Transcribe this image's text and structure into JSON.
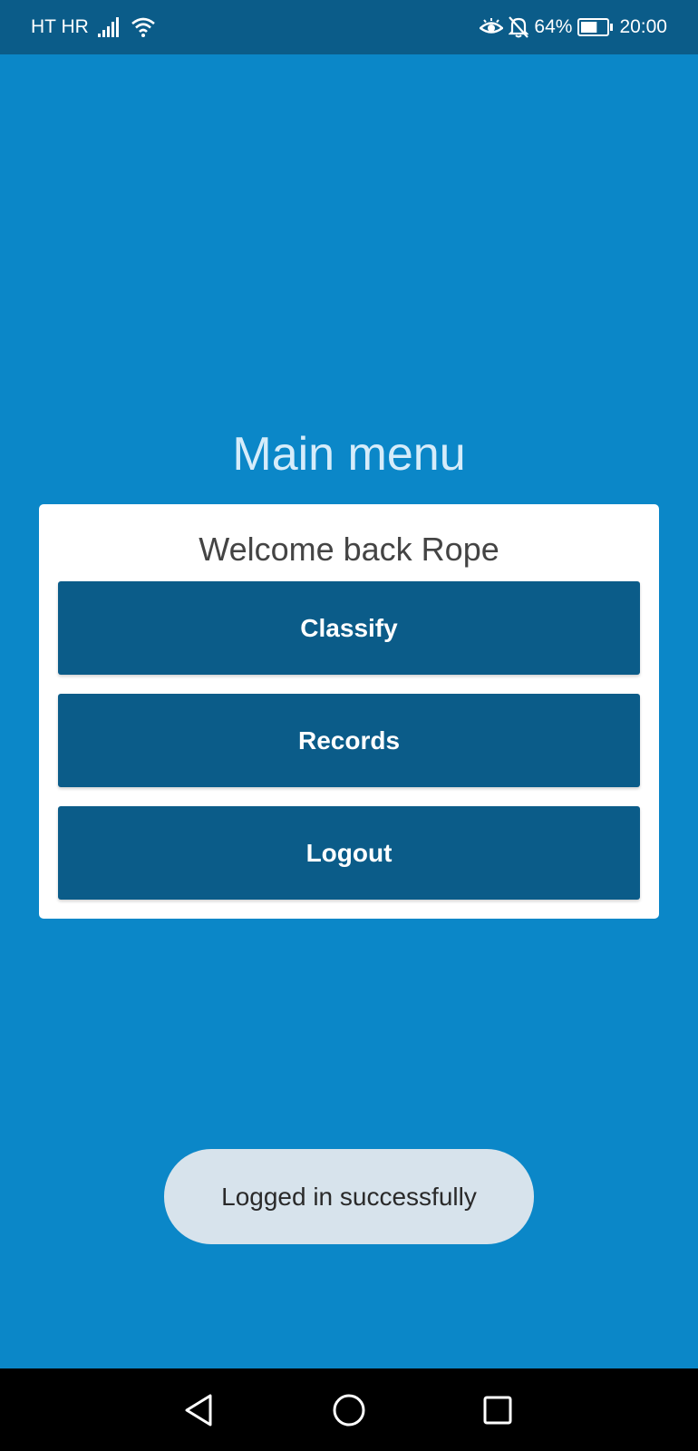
{
  "status_bar": {
    "carrier": "HT HR",
    "battery_percent": "64%",
    "battery_level": 0.64,
    "time": "20:00",
    "icons": [
      "signal-icon",
      "wifi-icon",
      "eye-icon",
      "bell-off-icon",
      "battery-icon"
    ]
  },
  "page": {
    "title": "Main menu"
  },
  "card": {
    "welcome": "Welcome back Rope",
    "buttons": {
      "classify": "Classify",
      "records": "Records",
      "logout": "Logout"
    }
  },
  "toast": {
    "message": "Logged in successfully"
  },
  "nav_bar": {
    "icons": [
      "back-icon",
      "home-icon",
      "recents-icon"
    ]
  },
  "colors": {
    "background": "#0b87c8",
    "status_bar": "#0b5c89",
    "button": "#0b5c89",
    "card": "#ffffff",
    "toast": "#d7e3ec",
    "nav_bar": "#000000"
  }
}
